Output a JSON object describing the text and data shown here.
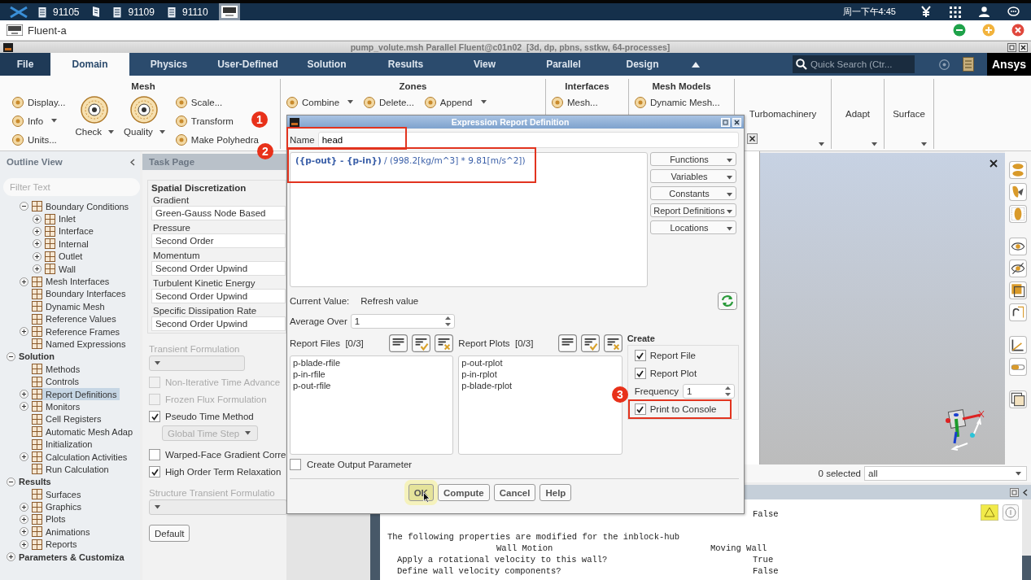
{
  "taskbar": {
    "items": [
      {
        "kind": "task",
        "label": "91105",
        "active": false
      },
      {
        "kind": "icon",
        "active": false
      },
      {
        "kind": "task",
        "label": "91109",
        "active": false
      },
      {
        "kind": "task",
        "label": "91110",
        "active": false
      },
      {
        "kind": "icon",
        "active": true
      }
    ],
    "clock": "周一下午4:45"
  },
  "app_window": {
    "title": "Fluent-a"
  },
  "window": {
    "title": "pump_volute.msh Parallel Fluent@c01n02  [3d, dp, pbns, sstkw, 64-processes]"
  },
  "menu": {
    "tabs": [
      {
        "kind": "file",
        "label": "File",
        "selected": false
      },
      {
        "kind": "tab",
        "label": "Domain",
        "selected": true
      },
      {
        "kind": "tab",
        "label": "Physics",
        "selected": false
      },
      {
        "kind": "tab",
        "label": "User-Defined",
        "selected": false
      },
      {
        "kind": "tab",
        "label": "Solution",
        "selected": false
      },
      {
        "kind": "tab",
        "label": "Results",
        "selected": false
      },
      {
        "kind": "tab",
        "label": "View",
        "selected": false
      },
      {
        "kind": "tab",
        "label": "Parallel",
        "selected": false
      },
      {
        "kind": "tab",
        "label": "Design",
        "selected": false
      }
    ],
    "search": {
      "placeholder": "Quick Search (Ctr..."
    },
    "logo": "Ansys"
  },
  "ribbon": {
    "groups": [
      {
        "kind": "tools",
        "title": "Mesh",
        "columns": [
          {
            "kind": "small",
            "items": [
              {
                "label": "Display...",
                "dropdown": false
              },
              {
                "label": "Info",
                "dropdown": true
              },
              {
                "label": "Units...",
                "dropdown": false
              }
            ]
          },
          {
            "kind": "large",
            "items": [
              {
                "label": "Check",
                "dropdown": true
              }
            ]
          },
          {
            "kind": "large",
            "items": [
              {
                "label": "Quality",
                "dropdown": true
              }
            ]
          },
          {
            "kind": "small",
            "items": [
              {
                "label": "Scale...",
                "dropdown": false
              },
              {
                "label": "Transform",
                "dropdown": false
              },
              {
                "label": "Make Polyhedra",
                "dropdown": false
              }
            ]
          }
        ]
      },
      {
        "kind": "tools",
        "title": "Zones",
        "columns": [
          {
            "kind": "small",
            "items": [
              {
                "label": "Combine",
                "dropdown": true
              }
            ]
          },
          {
            "kind": "small",
            "items": [
              {
                "label": "Delete...",
                "dropdown": false
              }
            ]
          },
          {
            "kind": "small",
            "items": [
              {
                "label": "Append",
                "dropdown": true
              }
            ]
          }
        ]
      },
      {
        "kind": "tools",
        "title": "Interfaces",
        "columns": [
          {
            "kind": "small",
            "items": [
              {
                "label": "Mesh...",
                "dropdown": false
              }
            ]
          }
        ]
      },
      {
        "kind": "tools",
        "title": "Mesh Models",
        "columns": [
          {
            "kind": "small",
            "items": [
              {
                "label": "Dynamic Mesh...",
                "dropdown": false
              }
            ]
          }
        ]
      },
      {
        "kind": "menu",
        "title": "Turbomachinery"
      },
      {
        "kind": "menu",
        "title": "Adapt"
      },
      {
        "kind": "menu",
        "title": "Surface"
      }
    ]
  },
  "outline": {
    "title": "Outline View",
    "filter": {
      "placeholder": "Filter Text"
    },
    "items": [
      {
        "kind": "item",
        "label": "Boundary Conditions",
        "expanded": true,
        "selected": false,
        "children": [
          {
            "kind": "item",
            "label": "Inlet",
            "expanded": false,
            "selected": false
          },
          {
            "kind": "item",
            "label": "Interface",
            "expanded": false,
            "selected": false
          },
          {
            "kind": "item",
            "label": "Internal",
            "expanded": false,
            "selected": false
          },
          {
            "kind": "item",
            "label": "Outlet",
            "expanded": false,
            "selected": false
          },
          {
            "kind": "item",
            "label": "Wall",
            "expanded": false,
            "selected": false
          }
        ]
      },
      {
        "kind": "item",
        "label": "Mesh Interfaces",
        "expanded": false,
        "selected": false
      },
      {
        "kind": "item",
        "label": "Boundary Interfaces",
        "selected": false
      },
      {
        "kind": "item",
        "label": "Dynamic Mesh",
        "selected": false
      },
      {
        "kind": "item",
        "label": "Reference Values",
        "selected": false
      },
      {
        "kind": "item",
        "label": "Reference Frames",
        "expanded": false,
        "selected": false
      },
      {
        "kind": "item",
        "label": "Named Expressions",
        "selected": false
      },
      {
        "kind": "section",
        "label": "Solution",
        "expanded": true,
        "selected": false,
        "children": [
          {
            "kind": "item",
            "label": "Methods",
            "selected": false
          },
          {
            "kind": "item",
            "label": "Controls",
            "selected": false
          },
          {
            "kind": "item",
            "label": "Report Definitions",
            "expanded": false,
            "selected": true
          },
          {
            "kind": "item",
            "label": "Monitors",
            "expanded": false,
            "selected": false
          },
          {
            "kind": "item",
            "label": "Cell Registers",
            "selected": false
          },
          {
            "kind": "item",
            "label": "Automatic Mesh Adap",
            "selected": false
          },
          {
            "kind": "item",
            "label": "Initialization",
            "selected": false
          },
          {
            "kind": "item",
            "label": "Calculation Activities",
            "expanded": false,
            "selected": false
          },
          {
            "kind": "item",
            "label": "Run Calculation",
            "selected": false
          }
        ]
      },
      {
        "kind": "section",
        "label": "Results",
        "expanded": true,
        "selected": false,
        "children": [
          {
            "kind": "item",
            "label": "Surfaces",
            "selected": false
          },
          {
            "kind": "item",
            "label": "Graphics",
            "expanded": false,
            "selected": false
          },
          {
            "kind": "item",
            "label": "Plots",
            "expanded": false,
            "selected": false
          },
          {
            "kind": "item",
            "label": "Animations",
            "expanded": false,
            "selected": false
          },
          {
            "kind": "item",
            "label": "Reports",
            "expanded": false,
            "selected": false
          }
        ]
      },
      {
        "kind": "section",
        "label": "Parameters & Customiza",
        "expanded": false,
        "selected": false
      }
    ]
  },
  "task_page": {
    "title": "Task Page",
    "group": {
      "title": "Spatial Discretization",
      "fields": [
        {
          "label": "Gradient",
          "value": "Green-Gauss Node Based"
        },
        {
          "label": "Pressure",
          "value": "Second Order"
        },
        {
          "label": "Momentum",
          "value": "Second Order Upwind"
        },
        {
          "label": "Turbulent Kinetic Energy",
          "value": "Second Order Upwind"
        },
        {
          "label": "Specific Dissipation Rate",
          "value": "Second Order Upwind"
        }
      ]
    },
    "controls": [
      {
        "kind": "heading",
        "label": "Transient Formulation",
        "disabled": true
      },
      {
        "kind": "dropdown",
        "disabled": true
      },
      {
        "kind": "checkbox",
        "label": "Non-Iterative Time Advance",
        "checked": false,
        "disabled": true
      },
      {
        "kind": "checkbox",
        "label": "Frozen Flux Formulation",
        "checked": false,
        "disabled": true
      },
      {
        "kind": "checkbox",
        "label": "Pseudo Time Method",
        "checked": true,
        "disabled": false
      },
      {
        "kind": "subdropdown",
        "value": "Global Time Step",
        "disabled": true
      },
      {
        "kind": "checkbox",
        "label": "Warped-Face Gradient Corre",
        "checked": false,
        "disabled": false
      },
      {
        "kind": "checkbox",
        "label": "High Order Term Relaxation",
        "checked": true,
        "disabled": false
      },
      {
        "kind": "heading",
        "label": "Structure Transient Formulatio",
        "disabled": true
      },
      {
        "kind": "widedropdown",
        "disabled": true
      }
    ],
    "default_button": "Default"
  },
  "dialog": {
    "title": "Expression Report Definition",
    "name": {
      "label": "Name",
      "value": "head",
      "highlighted": true
    },
    "expression": {
      "value": "**({p-out} - {p-in})** / (998.2[kg/m^3] * 9.81[m/s^2])",
      "highlighted": true
    },
    "menus": [
      "Functions",
      "Variables",
      "Constants",
      "Report Definitions",
      "Locations"
    ],
    "current_value": {
      "label": "Current Value:",
      "value": "Refresh value"
    },
    "average_over": {
      "label": "Average Over",
      "value": "1"
    },
    "report_files": {
      "label": "Report Files  [0/3]",
      "items": [
        "p-blade-rfile",
        "p-in-rfile",
        "p-out-rfile"
      ]
    },
    "report_plots": {
      "label": "Report Plots  [0/3]",
      "items": [
        "p-out-rplot",
        "p-in-rplot",
        "p-blade-rplot"
      ]
    },
    "create": {
      "title": "Create",
      "options": [
        {
          "kind": "checkbox",
          "label": "Report File",
          "checked": true,
          "highlighted": false
        },
        {
          "kind": "checkbox",
          "label": "Report Plot",
          "checked": true,
          "highlighted": false
        },
        {
          "kind": "spin",
          "label": "Frequency",
          "value": "1"
        },
        {
          "kind": "checkbox",
          "label": "Print to Console",
          "checked": true,
          "highlighted": true
        }
      ]
    },
    "output_parameter": {
      "label": "Create Output Parameter",
      "checked": false
    },
    "buttons": [
      {
        "label": "OK",
        "hovered": true
      },
      {
        "label": "Compute",
        "hovered": false
      },
      {
        "label": "Cancel",
        "hovered": false
      },
      {
        "label": "Help",
        "hovered": false
      }
    ]
  },
  "callouts": [
    {
      "label": "1"
    },
    {
      "label": "2"
    },
    {
      "label": "3"
    }
  ],
  "graphics": {
    "selection": {
      "count": "0 selected",
      "filter": "all"
    }
  },
  "console": {
    "lines": [
      {
        "kind": "value",
        "value": "False"
      },
      {
        "kind": "heading",
        "text": "The following properties are modified for the inblock-hub"
      },
      {
        "kind": "pair",
        "text": "Wall Motion",
        "value": "Moving Wall"
      },
      {
        "kind": "question",
        "text": "Apply a rotational velocity to this wall?",
        "value": "True"
      },
      {
        "kind": "question",
        "text": "Define wall velocity components?",
        "value": "False"
      }
    ]
  }
}
